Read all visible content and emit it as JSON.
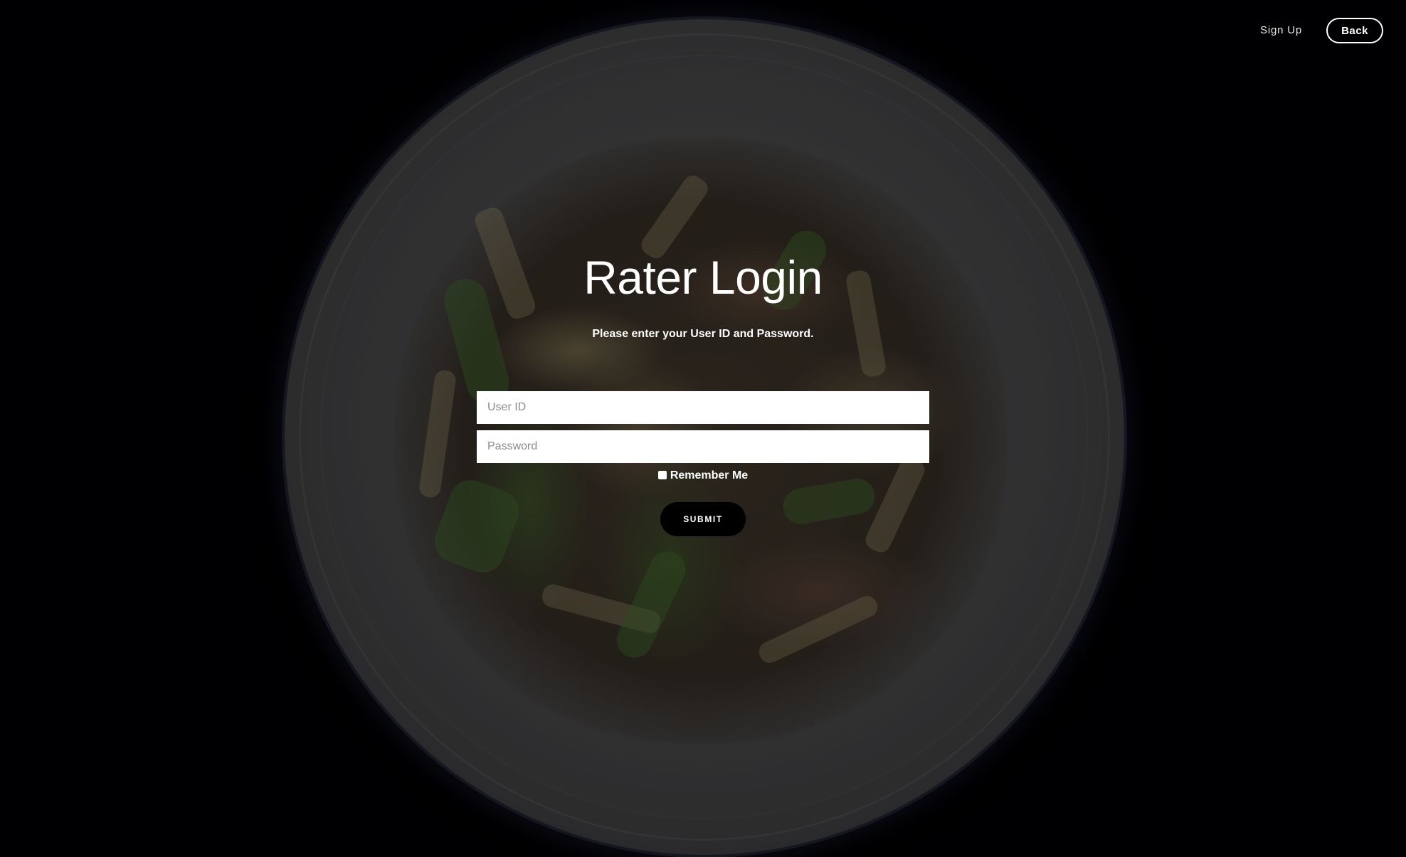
{
  "nav": {
    "signup_label": "Sign Up",
    "back_label": "Back"
  },
  "login": {
    "title": "Rater Login",
    "subtitle": "Please enter your User ID and Password.",
    "userid_placeholder": "User ID",
    "userid_value": "",
    "password_placeholder": "Password",
    "password_value": "",
    "remember_label": "Remember Me",
    "remember_checked": false,
    "submit_label": "SUBMIT"
  },
  "colors": {
    "background": "#020204",
    "text": "#ffffff",
    "submit_bg": "#000000",
    "field_bg": "#ffffff"
  }
}
